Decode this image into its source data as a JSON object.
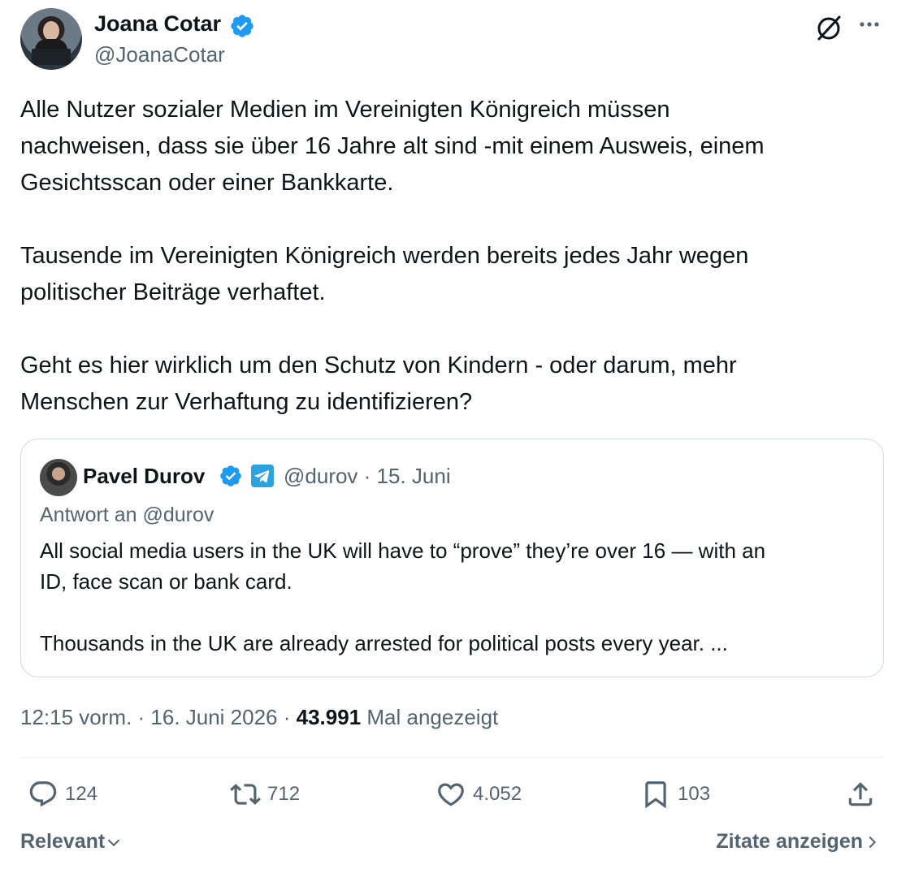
{
  "author": {
    "name": "Joana Cotar",
    "handle": "@JoanaCotar"
  },
  "tweet": {
    "text": "Alle Nutzer sozialer Medien im Vereinigten Königreich müssen\nnachweisen, dass sie über 16 Jahre alt sind -mit einem Ausweis, einem\nGesichtsscan oder einer Bankkarte.\n\nTausende im Vereinigten Königreich werden bereits jedes Jahr wegen\npolitischer Beiträge verhaftet.\n\nGeht es hier wirklich um den Schutz von Kindern - oder darum, mehr\nMenschen zur Verhaftung zu identifizieren?"
  },
  "quote": {
    "name": "Pavel Durov",
    "handle_date": "@durov · 15. Juni",
    "reply_to": "Antwort an @durov",
    "text": "All social media users in the UK will have to “prove” they’re over 16 — with an\nID, face scan or bank card.\n\nThousands in the UK are already arrested for political posts every year. ..."
  },
  "meta": {
    "time_date": "12:15 vorm. · 16. Juni 2026 · ",
    "views": "43.991",
    "views_label": " Mal angezeigt"
  },
  "actions": {
    "replies": "124",
    "reposts": "712",
    "likes": "4.052",
    "bookmarks": "103"
  },
  "footer": {
    "sort_label": "Relevant",
    "quotes_label": "Zitate anzeigen"
  },
  "colors": {
    "verified": "#1d9bf0",
    "telegram": "#2aa3df",
    "secondary_text": "#536471",
    "border": "#cfd9de"
  },
  "icons": [
    "grok-icon",
    "more-icon",
    "verified-badge-icon",
    "telegram-icon",
    "reply-icon",
    "repost-icon",
    "like-icon",
    "bookmark-icon",
    "share-icon",
    "chevron-down-icon",
    "chevron-right-icon"
  ]
}
